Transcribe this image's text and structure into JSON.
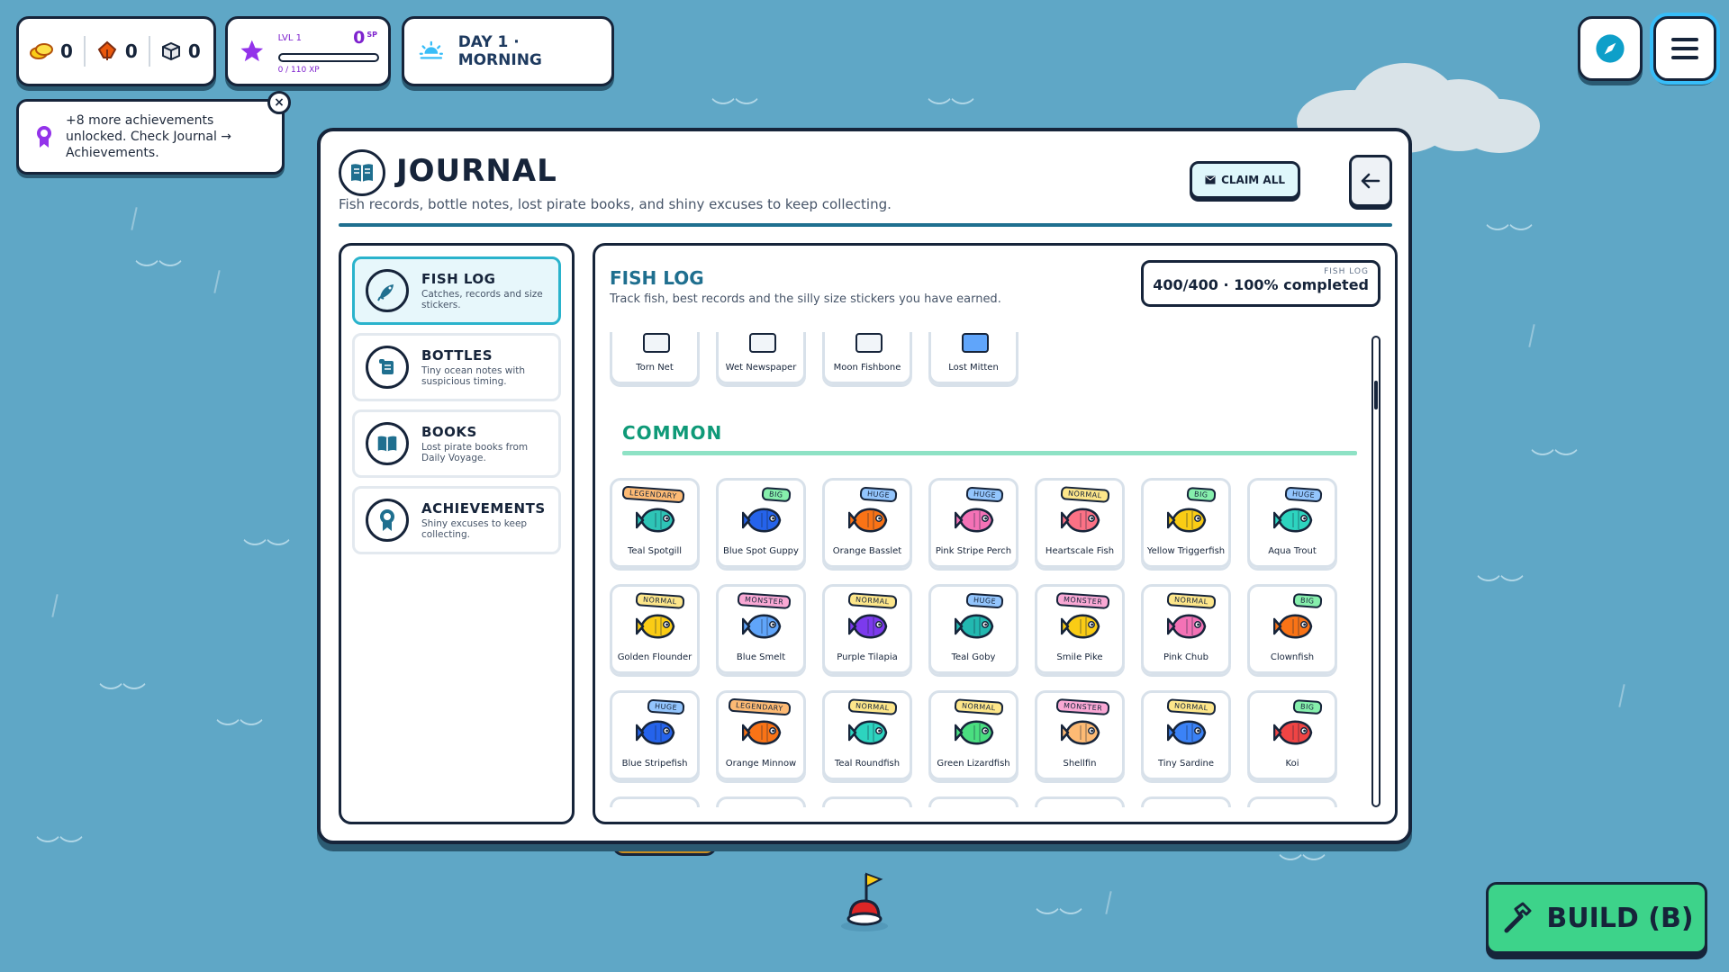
{
  "hud": {
    "resources": [
      {
        "icon": "coins-icon",
        "value": "0"
      },
      {
        "icon": "wood-icon",
        "value": "0"
      },
      {
        "icon": "crate-icon",
        "value": "0"
      }
    ],
    "level": {
      "label": "LVL 1",
      "sp": "0",
      "sp_unit": "SP",
      "xp_text": "0 / 110 XP",
      "xp_fraction": 0.0
    },
    "day": "DAY 1 · MORNING"
  },
  "toast": {
    "text": "+8 more achievements unlocked. Check Journal → Achievements.",
    "close": "×"
  },
  "journal": {
    "title": "JOURNAL",
    "subtitle": "Fish records, bottle notes, lost pirate books, and shiny excuses to keep collecting.",
    "claim_all": "CLAIM ALL",
    "nav": [
      {
        "id": "fish-log",
        "title": "FISH LOG",
        "desc": "Catches, records and size stickers.",
        "active": true
      },
      {
        "id": "bottles",
        "title": "BOTTLES",
        "desc": "Tiny ocean notes with suspicious timing.",
        "active": false
      },
      {
        "id": "books",
        "title": "BOOKS",
        "desc": "Lost pirate books from Daily Voyage.",
        "active": false
      },
      {
        "id": "achievements",
        "title": "ACHIEVEMENTS",
        "desc": "Shiny excuses to keep collecting.",
        "active": false
      }
    ],
    "section": {
      "title": "FISH LOG",
      "subtitle": "Track fish, best records and the silly size stickers you have earned.",
      "progress_label": "FISH LOG",
      "progress_value": "400/400 · 100% completed"
    },
    "junk": [
      "Torn Net",
      "Wet Newspaper",
      "Moon Fishbone",
      "Lost Mitten"
    ],
    "common_heading": "COMMON",
    "fish": [
      {
        "name": "Teal Spotgill",
        "size": "LEGENDARY",
        "color": "#2ec4b6"
      },
      {
        "name": "Blue Spot Guppy",
        "size": "BIG",
        "color": "#2563eb"
      },
      {
        "name": "Orange Basslet",
        "size": "HUGE",
        "color": "#f97316"
      },
      {
        "name": "Pink Stripe Perch",
        "size": "HUGE",
        "color": "#f472b6"
      },
      {
        "name": "Heartscale Fish",
        "size": "NORMAL",
        "color": "#fb7185"
      },
      {
        "name": "Yellow Triggerfish",
        "size": "BIG",
        "color": "#facc15"
      },
      {
        "name": "Aqua Trout",
        "size": "HUGE",
        "color": "#2dd4bf"
      },
      {
        "name": "Golden Flounder",
        "size": "NORMAL",
        "color": "#facc15"
      },
      {
        "name": "Blue Smelt",
        "size": "MONSTER",
        "color": "#60a5fa"
      },
      {
        "name": "Purple Tilapia",
        "size": "NORMAL",
        "color": "#7c3aed"
      },
      {
        "name": "Teal Goby",
        "size": "HUGE",
        "color": "#22b8b0"
      },
      {
        "name": "Smile Pike",
        "size": "MONSTER",
        "color": "#facc15"
      },
      {
        "name": "Pink Chub",
        "size": "NORMAL",
        "color": "#f472b6"
      },
      {
        "name": "Clownfish",
        "size": "BIG",
        "color": "#f97316"
      },
      {
        "name": "Blue Stripefish",
        "size": "HUGE",
        "color": "#2563eb"
      },
      {
        "name": "Orange Minnow",
        "size": "LEGENDARY",
        "color": "#f97316"
      },
      {
        "name": "Teal Roundfish",
        "size": "NORMAL",
        "color": "#2dd4bf"
      },
      {
        "name": "Green Lizardfish",
        "size": "NORMAL",
        "color": "#4ade80"
      },
      {
        "name": "Shellfin",
        "size": "MONSTER",
        "color": "#fdba74"
      },
      {
        "name": "Tiny Sardine",
        "size": "NORMAL",
        "color": "#3b82f6"
      },
      {
        "name": "Koi",
        "size": "BIG",
        "color": "#ef4444"
      }
    ],
    "tag_colors": {
      "LEGENDARY": "#fdba74",
      "BIG": "#86efac",
      "HUGE": "#93c5fd",
      "NORMAL": "#fde68a",
      "MONSTER": "#f9a8d4"
    }
  },
  "build": "BUILD (B)"
}
